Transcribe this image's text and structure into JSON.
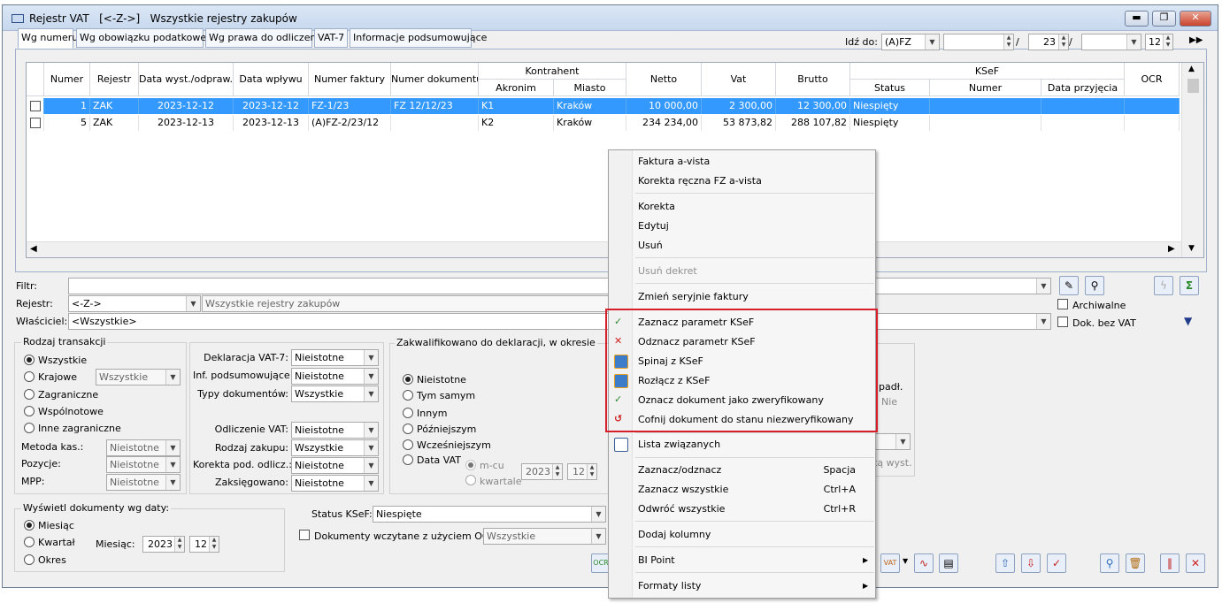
{
  "window": {
    "title": "Rejestr VAT   [<-Z->]   Wszystkie rejestry zakupów"
  },
  "tabs": [
    "Wg numeru",
    "Wg obowiązku podatkowego",
    "Wg prawa do odliczenia",
    "VAT-7",
    "Informacje podsumowujące"
  ],
  "goto": {
    "label": "Idź do:",
    "series": "(A)FZ",
    "number": "",
    "month": "23",
    "year": "",
    "month2": "12",
    "slash1": "/",
    "slash2": "/"
  },
  "grid": {
    "headers": {
      "numer": "Numer",
      "rejestr": "Rejestr",
      "data_wyst": "Data wyst./odpraw.(+",
      "data_wplywu": "Data wpływu",
      "numer_faktury": "Numer faktury",
      "numer_dokumentu": "Numer dokumentu",
      "kontrahent": "Kontrahent",
      "akronim": "Akronim",
      "miasto": "Miasto",
      "netto": "Netto",
      "vat": "Vat",
      "brutto": "Brutto",
      "ksef": "KSeF",
      "status": "Status",
      "ksef_numer": "Numer",
      "data_przyjecia": "Data przyjęcia",
      "ocr": "OCR"
    },
    "rows": [
      {
        "numer": "1",
        "rejestr": "ZAK",
        "data_wyst": "2023-12-12",
        "data_wplywu": "2023-12-12",
        "numer_faktury": "FZ-1/23",
        "numer_dokumentu": "FZ 12/12/23",
        "akronim": "K1",
        "miasto": "Kraków",
        "netto": "10 000,00",
        "vat": "2 300,00",
        "brutto": "12 300,00",
        "status": "Niespięty"
      },
      {
        "numer": "5",
        "rejestr": "ZAK",
        "data_wyst": "2023-12-13",
        "data_wplywu": "2023-12-13",
        "numer_faktury": "(A)FZ-2/23/12",
        "numer_dokumentu": "",
        "akronim": "K2",
        "miasto": "Kraków",
        "netto": "234 234,00",
        "vat": "53 873,82",
        "brutto": "288 107,82",
        "status": "Niespięty"
      }
    ]
  },
  "filters": {
    "filtr_label": "Filtr:",
    "filtr_value": "",
    "rejestr_label": "Rejestr:",
    "rejestr_value": "<-Z->",
    "rejestr_desc": "Wszystkie rejestry zakupów",
    "wlasciciel_label": "Właściciel:",
    "wlasciciel_value": "<Wszystkie>",
    "archiwalne": "Archiwalne",
    "bez_vat": "Dok. bez VAT"
  },
  "rodzaj": {
    "title": "Rodzaj transakcji",
    "options": [
      "Wszystkie",
      "Krajowe",
      "Zagraniczne",
      "Wspólnotowe",
      "Inne zagraniczne"
    ],
    "krajowe_value": "Wszystkie",
    "metoda_label": "Metoda kas.:",
    "metoda_value": "Nieistotne",
    "pozycje_label": "Pozycje:",
    "pozycje_value": "Nieistotne",
    "mpp_label": "MPP:",
    "mpp_value": "Nieistotne"
  },
  "deklaracja": {
    "items": [
      {
        "label": "Deklaracja VAT-7:",
        "value": "Nieistotne"
      },
      {
        "label": "Inf. podsumowujące:",
        "value": "Nieistotne"
      },
      {
        "label": "Typy dokumentów:",
        "value": "Wszystkie"
      },
      {
        "label": "Odliczenie VAT:",
        "value": "Nieistotne"
      },
      {
        "label": "Rodzaj zakupu:",
        "value": "Wszystkie"
      },
      {
        "label": "Korekta pod. odlicz.:",
        "value": "Nieistotne"
      },
      {
        "label": "Zaksięgowano:",
        "value": "Nieistotne"
      }
    ]
  },
  "zakwalifikowano": {
    "title": "Zakwalifikowano do deklaracji, w okresie",
    "options": [
      "Nieistotne",
      "Tym samym",
      "Innym",
      "Późniejszym",
      "Wcześniejszym",
      "Data VAT"
    ],
    "mcu": "m-cu",
    "kwartale": "kwartale",
    "year": "2023",
    "month": "12"
  },
  "wyswietl": {
    "title": "Wyświetl dokumenty wg daty:",
    "options": [
      "Miesiąc",
      "Kwartał",
      "Okres"
    ],
    "miesiac_label": "Miesiąc:",
    "year": "2023",
    "month": "12"
  },
  "ksef_filter": {
    "label": "Status KSeF:",
    "value": "Niespięte",
    "ocr_label": "Dokumenty wczytane z użyciem OCR",
    "ocr_value": "Wszystkie"
  },
  "hidden_panel": {
    "padl": "padł.",
    "nie": "Nie",
    "wyst": "tą wyst."
  },
  "menu": {
    "items": [
      {
        "label": "Faktura a-vista",
        "disabled": false
      },
      {
        "label": "Korekta ręczna FZ a-vista",
        "disabled": false
      },
      {
        "label": "Korekta",
        "disabled": false
      },
      {
        "label": "Edytuj",
        "disabled": false
      },
      {
        "label": "Usuń",
        "disabled": false
      },
      {
        "label": "Usuń dekret",
        "disabled": true
      },
      {
        "label": "Zmień seryjnie faktury",
        "disabled": false
      },
      {
        "label": "Zaznacz parametr KSeF",
        "icon": "ksef-check-icon"
      },
      {
        "label": "Odznacz parametr KSeF",
        "icon": "ksef-uncheck-icon"
      },
      {
        "label": "Spinaj z KSeF",
        "icon": "link-icon"
      },
      {
        "label": "Rozłącz z KSeF",
        "icon": "unlink-icon"
      },
      {
        "label": "Oznacz dokument jako zweryfikowany",
        "icon": "ksef-verify-icon"
      },
      {
        "label": "Cofnij dokument do stanu niezweryfikowany",
        "icon": "ksef-unverify-icon"
      },
      {
        "label": "Lista związanych",
        "icon": "list-icon"
      },
      {
        "label": "Zaznacz/odznacz",
        "shortcut": "Spacja"
      },
      {
        "label": "Zaznacz wszystkie",
        "shortcut": "Ctrl+A"
      },
      {
        "label": "Odwróć wszystkie",
        "shortcut": "Ctrl+R"
      },
      {
        "label": "Dodaj kolumny"
      },
      {
        "label": "BI Point",
        "submenu": true
      },
      {
        "label": "Formaty listy",
        "submenu": true
      }
    ]
  },
  "colors": {
    "selection": "#3399ff",
    "highlight_box": "#d61f2b"
  }
}
